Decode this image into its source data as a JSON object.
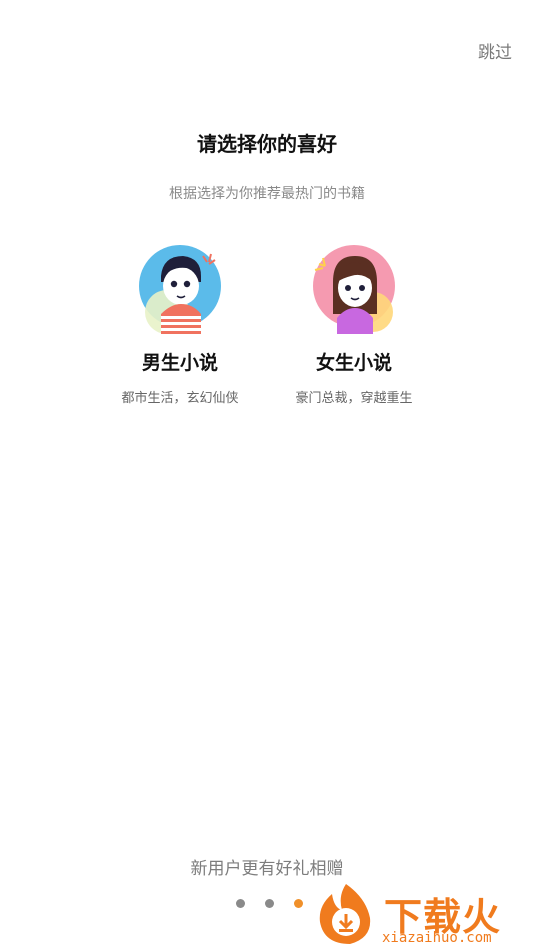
{
  "header": {
    "skip_label": "跳过"
  },
  "main": {
    "title": "请选择你的喜好",
    "subtitle": "根据选择为你推荐最热门的书籍",
    "options": [
      {
        "title": "男生小说",
        "desc": "都市生活，玄幻仙侠",
        "avatar_icon": "boy-avatar-icon",
        "avatar_color": "#5bbbea"
      },
      {
        "title": "女生小说",
        "desc": "豪门总裁，穿越重生",
        "avatar_icon": "girl-avatar-icon",
        "avatar_color": "#f59ab0"
      }
    ]
  },
  "footer": {
    "promo": "新用户更有好礼相赠",
    "pagination": {
      "total": 3,
      "active": 3,
      "active_color": "#f0902a",
      "inactive_color": "#8a8a8a"
    }
  },
  "watermark": {
    "brand": "下载火",
    "url": "xiazaihuo.com",
    "color": "#f07b1e"
  }
}
